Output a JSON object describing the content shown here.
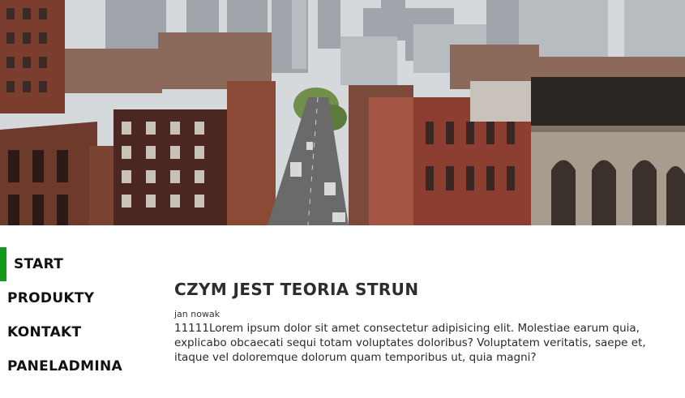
{
  "hero": {
    "image_alt": "city street panorama",
    "palette": {
      "sky": "#d6d9dc",
      "brick": "#7a3d2e",
      "brick_dark": "#4c2620",
      "stone": "#a89c8e",
      "street": "#6a6a6a",
      "trees": "#6f8f4a"
    }
  },
  "nav": {
    "accent_color": "#119a1b",
    "items": [
      {
        "label": "START",
        "active": true
      },
      {
        "label": "PRODUKTY",
        "active": false
      },
      {
        "label": "KONTAKT",
        "active": false
      },
      {
        "label": "PANELADMINA",
        "active": false
      }
    ]
  },
  "article": {
    "title": "CZYM JEST TEORIA STRUN",
    "author": "jan nowak",
    "body": "11111Lorem ipsum dolor sit amet consectetur adipisicing elit. Molestiae earum quia, explicabo obcaecati sequi totam voluptates doloribus? Voluptatem veritatis, saepe et, itaque vel doloremque dolorum quam temporibus ut, quia magni?"
  }
}
